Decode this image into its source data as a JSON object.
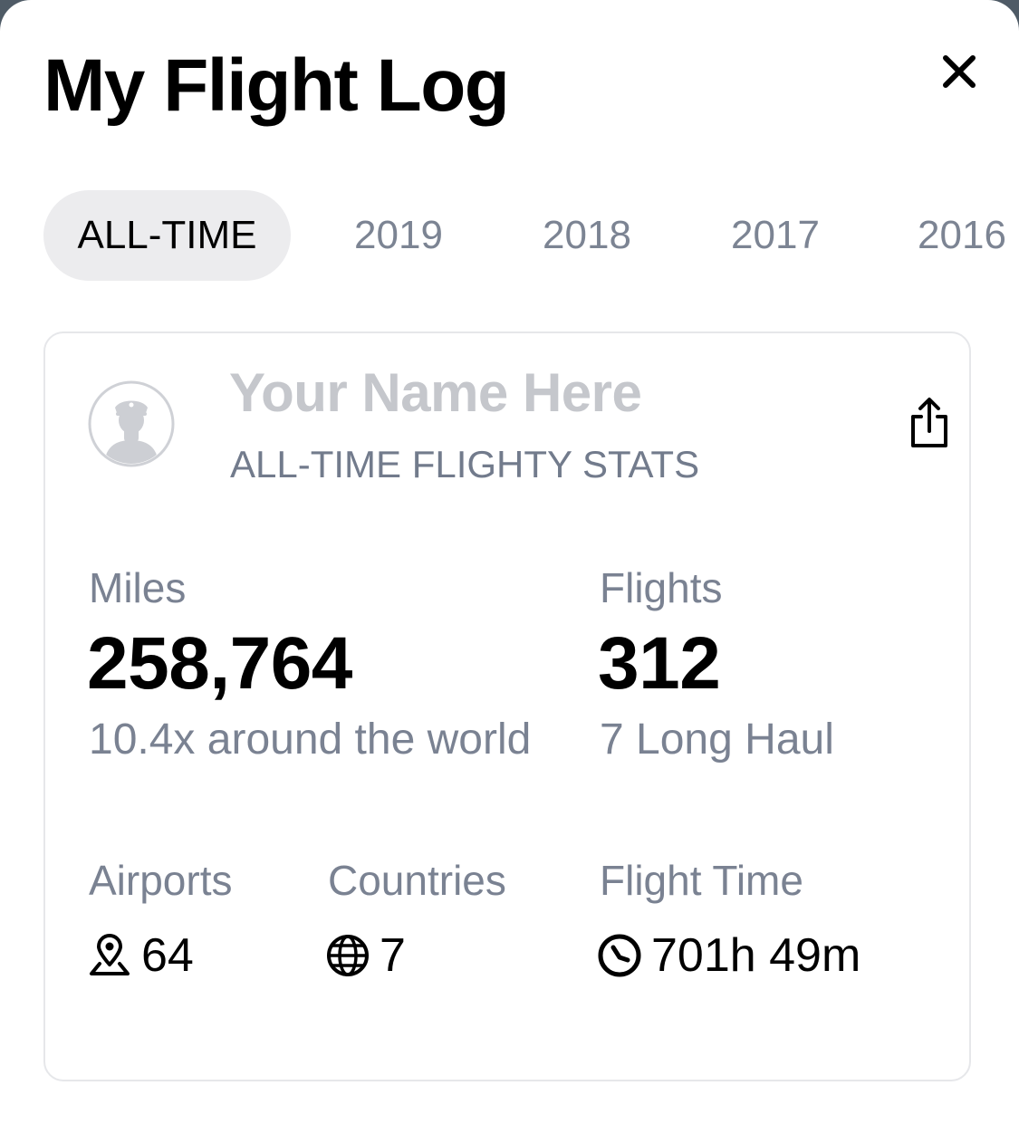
{
  "header": {
    "title": "My Flight Log",
    "close_icon": "close-icon"
  },
  "tabs": [
    {
      "label": "ALL-TIME",
      "active": true
    },
    {
      "label": "2019",
      "active": false
    },
    {
      "label": "2018",
      "active": false
    },
    {
      "label": "2017",
      "active": false
    },
    {
      "label": "2016",
      "active": false
    }
  ],
  "card": {
    "avatar_icon": "pilot-avatar-icon",
    "name": "Your Name Here",
    "subtitle": "ALL-TIME FLIGHTY STATS",
    "share_icon": "share-icon",
    "miles": {
      "label": "Miles",
      "value": "258,764",
      "note": "10.4x around the world"
    },
    "flights": {
      "label": "Flights",
      "value": "312",
      "note": "7 Long Haul"
    },
    "airports": {
      "label": "Airports",
      "icon": "map-pin-icon",
      "value": "64"
    },
    "countries": {
      "label": "Countries",
      "icon": "globe-icon",
      "value": "7"
    },
    "flight_time": {
      "label": "Flight Time",
      "icon": "clock-icon",
      "value": "701h 49m"
    }
  },
  "colors": {
    "primary_text": "#000000",
    "secondary_text": "#7a8292",
    "placeholder_text": "#c5c7cc",
    "active_tab_bg": "#ececee",
    "card_border": "#e6e7ea",
    "backdrop": "#4f5b66"
  }
}
